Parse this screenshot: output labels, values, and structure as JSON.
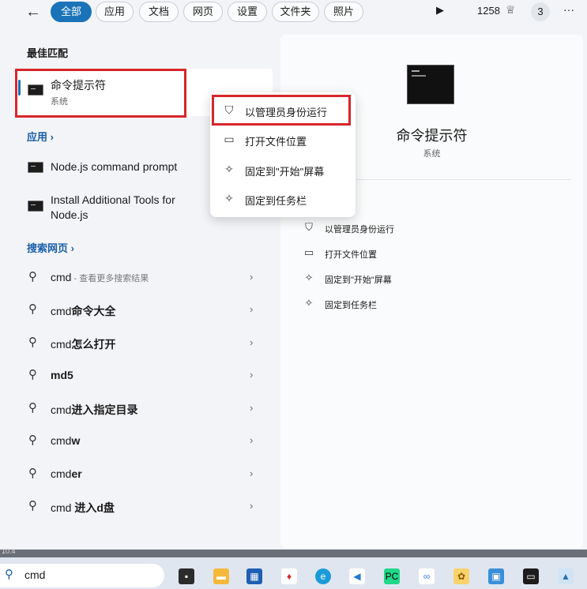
{
  "topbar": {
    "back_icon": "arrow-left-icon",
    "filters": [
      "全部",
      "应用",
      "文档",
      "网页",
      "设置",
      "文件夹",
      "照片"
    ],
    "active_filter": "全部",
    "points": "1258",
    "badge_count": "3",
    "more_label": "···"
  },
  "best_match": {
    "heading": "最佳匹配",
    "title": "命令提示符",
    "subtitle": "系统"
  },
  "apps": {
    "heading": "应用 ›",
    "items": [
      "Node.js command prompt",
      "Install Additional Tools for",
      "Node.js"
    ]
  },
  "web": {
    "heading": "搜索网页 ›",
    "rows": [
      {
        "prefix": "cmd",
        "bold": "",
        "hint": " - 查看更多搜索结果"
      },
      {
        "prefix": "cmd",
        "bold": "命令大全",
        "hint": ""
      },
      {
        "prefix": "cmd",
        "bold": "怎么打开",
        "hint": ""
      },
      {
        "prefix": "",
        "bold": "md5",
        "hint": ""
      },
      {
        "prefix": "cmd",
        "bold": "进入指定目录",
        "hint": ""
      },
      {
        "prefix": "cmd",
        "bold": "w",
        "hint": ""
      },
      {
        "prefix": "cmd",
        "bold": "er",
        "hint": ""
      },
      {
        "prefix": "cmd ",
        "bold": "进入d盘",
        "hint": ""
      }
    ]
  },
  "context_menu": {
    "items": [
      {
        "label": "以管理员身份运行",
        "icon": "shield-window-icon"
      },
      {
        "label": "打开文件位置",
        "icon": "folder-icon"
      },
      {
        "label": "固定到\"开始\"屏幕",
        "icon": "pin-icon"
      },
      {
        "label": "固定到任务栏",
        "icon": "pin-icon"
      }
    ]
  },
  "detail": {
    "title": "命令提示符",
    "subtitle": "系统",
    "actions": [
      {
        "label": "以管理员身份运行",
        "icon": "shield-window-icon"
      },
      {
        "label": "打开文件位置",
        "icon": "folder-icon"
      },
      {
        "label": "固定到\"开始\"屏幕",
        "icon": "pin-icon"
      },
      {
        "label": "固定到任务栏",
        "icon": "pin-icon"
      }
    ]
  },
  "taskbar": {
    "search_value": "cmd",
    "strip_text": "10.4",
    "apps": [
      "task-view",
      "file-explorer",
      "store",
      "app-red",
      "edge",
      "vscode",
      "pycharm",
      "baidu-netdisk",
      "notes",
      "monitor",
      "terminal",
      "image-viewer"
    ]
  },
  "colors": {
    "accent": "#1a73b8",
    "highlight_border": "#d7262b",
    "link": "#1a5fa8"
  }
}
